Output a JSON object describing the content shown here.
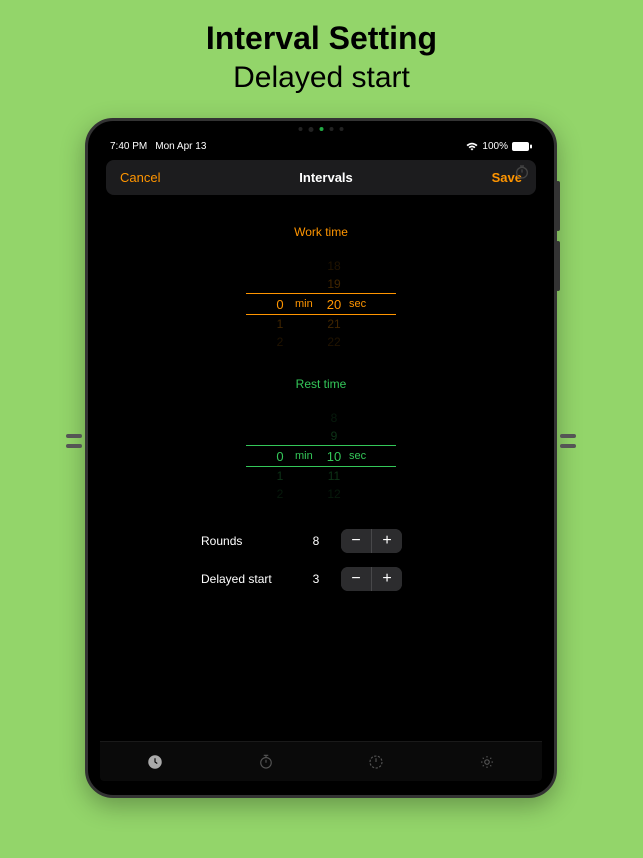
{
  "headline": {
    "title": "Interval Setting",
    "subtitle": "Delayed start"
  },
  "statusbar": {
    "time": "7:40 PM",
    "date": "Mon Apr 13",
    "battery": "100%"
  },
  "navbar": {
    "cancel": "Cancel",
    "title": "Intervals",
    "save": "Save"
  },
  "work": {
    "label": "Work time",
    "min": "0",
    "sec": "20",
    "min_unit": "min",
    "sec_unit": "sec",
    "above2": "18",
    "above1": "19",
    "below1_min": "1",
    "below1_sec": "21",
    "below2_min": "2",
    "below2_sec": "22"
  },
  "rest": {
    "label": "Rest time",
    "min": "0",
    "sec": "10",
    "min_unit": "min",
    "sec_unit": "sec",
    "above2": "8",
    "above1": "9",
    "below1_min": "1",
    "below1_sec": "11",
    "below2_min": "2",
    "below2_sec": "12"
  },
  "controls": {
    "rounds_label": "Rounds",
    "rounds_value": "8",
    "delayed_label": "Delayed start",
    "delayed_value": "3",
    "minus": "−",
    "plus": "+"
  }
}
